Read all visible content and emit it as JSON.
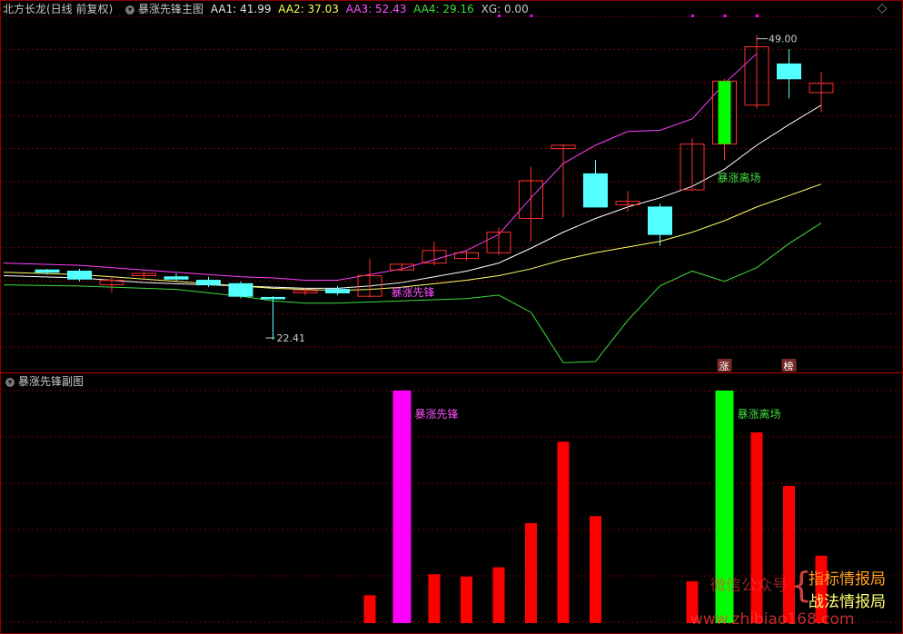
{
  "header": {
    "stock": "北方长龙(日线 前复权)",
    "indicator": "暴涨先锋主图",
    "aa1": "AA1: 41.99",
    "aa2": "AA2: 37.03",
    "aa3": "AA3: 52.43",
    "aa4": "AA4: 29.16",
    "xg": "XG: 0.00"
  },
  "sub_header": {
    "indicator": "暴涨先锋副图"
  },
  "colors": {
    "aa1": "#ffffff",
    "aa2": "#ffff66",
    "aa3": "#ff40ff",
    "aa4": "#40dd40",
    "up": "#ff3030",
    "down": "#54ffff",
    "grid": "#7a0000",
    "magenta": "#ff00ff",
    "green": "#00ff00"
  },
  "chart_data": [
    {
      "type": "candlestick",
      "title": "暴涨先锋主图",
      "ylim": [
        20.5,
        50.5
      ],
      "candles": [
        {
          "o": 28.5,
          "c": 28.3,
          "h": 28.6,
          "l": 28.1
        },
        {
          "o": 28.4,
          "c": 27.7,
          "h": 28.6,
          "l": 27.5
        },
        {
          "o": 27.2,
          "c": 27.6,
          "h": 27.9,
          "l": 26.5
        },
        {
          "o": 28.0,
          "c": 28.2,
          "h": 28.4,
          "l": 27.8
        },
        {
          "o": 27.9,
          "c": 27.7,
          "h": 28.2,
          "l": 27.5
        },
        {
          "o": 27.6,
          "c": 27.2,
          "h": 27.9,
          "l": 27.0
        },
        {
          "o": 27.3,
          "c": 26.2,
          "h": 27.5,
          "l": 26.0
        },
        {
          "o": 26.1,
          "c": 26.0,
          "h": 26.2,
          "l": 22.4
        },
        {
          "o": 26.5,
          "c": 26.7,
          "h": 26.9,
          "l": 26.3
        },
        {
          "o": 26.8,
          "c": 26.5,
          "h": 27.1,
          "l": 26.3
        },
        {
          "o": 26.2,
          "c": 28.0,
          "h": 29.5,
          "l": 26.1
        },
        {
          "o": 28.5,
          "c": 29.0,
          "h": 29.1,
          "l": 28.4
        },
        {
          "o": 29.1,
          "c": 30.2,
          "h": 31.0,
          "l": 28.9
        },
        {
          "o": 29.5,
          "c": 30.0,
          "h": 30.2,
          "l": 29.3
        },
        {
          "o": 30.0,
          "c": 31.8,
          "h": 32.2,
          "l": 29.8
        },
        {
          "o": 33.0,
          "c": 36.3,
          "h": 37.5,
          "l": 31.0
        },
        {
          "o": 39.1,
          "c": 39.4,
          "h": 39.5,
          "l": 33.1
        },
        {
          "o": 36.9,
          "c": 34.0,
          "h": 38.1,
          "l": 34.0
        },
        {
          "o": 34.2,
          "c": 34.5,
          "h": 35.4,
          "l": 33.6
        },
        {
          "o": 34.0,
          "c": 31.6,
          "h": 34.3,
          "l": 30.6
        },
        {
          "o": 35.5,
          "c": 39.5,
          "h": 40.0,
          "l": 35.4
        },
        {
          "o": 39.5,
          "c": 45.0,
          "h": 45.2,
          "l": 38.1
        },
        {
          "o": 42.9,
          "c": 48.0,
          "h": 49.0,
          "l": 42.6
        },
        {
          "o": 46.5,
          "c": 45.2,
          "h": 47.8,
          "l": 43.5
        },
        {
          "o": 44.0,
          "c": 44.8,
          "h": 45.8,
          "l": 42.3
        }
      ],
      "series": [
        {
          "name": "AA1",
          "values": [
            28.0,
            27.8,
            27.6,
            27.4,
            27.3,
            27.2,
            27.1,
            27.0,
            26.9,
            26.9,
            27.1,
            27.4,
            27.9,
            28.4,
            29.1,
            30.4,
            31.8,
            33.0,
            34.0,
            34.8,
            35.8,
            37.3,
            39.4,
            41.2,
            42.9
          ]
        },
        {
          "name": "AA2",
          "values": [
            28.3,
            28.1,
            27.9,
            27.7,
            27.5,
            27.3,
            27.1,
            26.9,
            26.8,
            26.7,
            26.8,
            27.0,
            27.3,
            27.6,
            28.0,
            28.6,
            29.4,
            30.0,
            30.5,
            31.0,
            31.8,
            32.8,
            34.0,
            35.0,
            36.0
          ]
        },
        {
          "name": "AA3",
          "values": [
            29.1,
            28.9,
            28.7,
            28.5,
            28.3,
            28.1,
            27.9,
            27.8,
            27.6,
            27.6,
            28.1,
            28.6,
            29.4,
            30.2,
            31.6,
            34.8,
            37.8,
            39.4,
            40.6,
            40.7,
            41.7,
            44.8,
            47.4,
            null,
            null
          ]
        },
        {
          "name": "AA4",
          "values": [
            27.2,
            27.1,
            27.0,
            26.9,
            26.8,
            26.5,
            26.2,
            25.8,
            25.6,
            25.6,
            25.7,
            25.8,
            25.9,
            26.0,
            26.3,
            24.8,
            20.4,
            20.5,
            24.1,
            27.1,
            28.4,
            27.5,
            28.7,
            30.8,
            32.6
          ]
        }
      ],
      "annotations": [
        {
          "text": "暴涨先锋",
          "index": 11,
          "y": 26.6
        },
        {
          "text": "暴涨离场",
          "index": 21,
          "y": 36.6
        },
        {
          "text": "49.00",
          "index": 22,
          "y": 48.7
        },
        {
          "text": "22.41",
          "index": 7,
          "y": 22.4
        }
      ],
      "signals": [
        {
          "text": "涨",
          "index": 21
        },
        {
          "text": "榜",
          "index": 23
        }
      ],
      "xg_markers": [
        14,
        15,
        20,
        21,
        22
      ]
    },
    {
      "type": "bar",
      "title": "暴涨先锋副图",
      "ylim": [
        0,
        100
      ],
      "values": [
        0,
        0,
        0,
        0,
        0,
        0,
        0,
        0,
        0,
        0,
        12,
        100,
        21,
        20,
        24,
        43,
        78,
        46,
        0,
        0,
        18,
        100,
        82,
        59,
        29
      ],
      "colors": [
        "",
        "",
        "",
        "",
        "",
        "",
        "",
        "",
        "",
        "",
        "red",
        "magenta",
        "red",
        "red",
        "red",
        "red",
        "red",
        "red",
        "",
        "",
        "red",
        "green",
        "red",
        "red",
        "red"
      ],
      "labels": [
        {
          "text": "暴涨先锋",
          "index": 11
        },
        {
          "text": "暴涨离场",
          "index": 21
        }
      ]
    }
  ],
  "watermark": {
    "wechat": "微信公众号",
    "line1": "指标情报局",
    "line2": "战法情报局",
    "url": "www.zhibiao168.com"
  }
}
